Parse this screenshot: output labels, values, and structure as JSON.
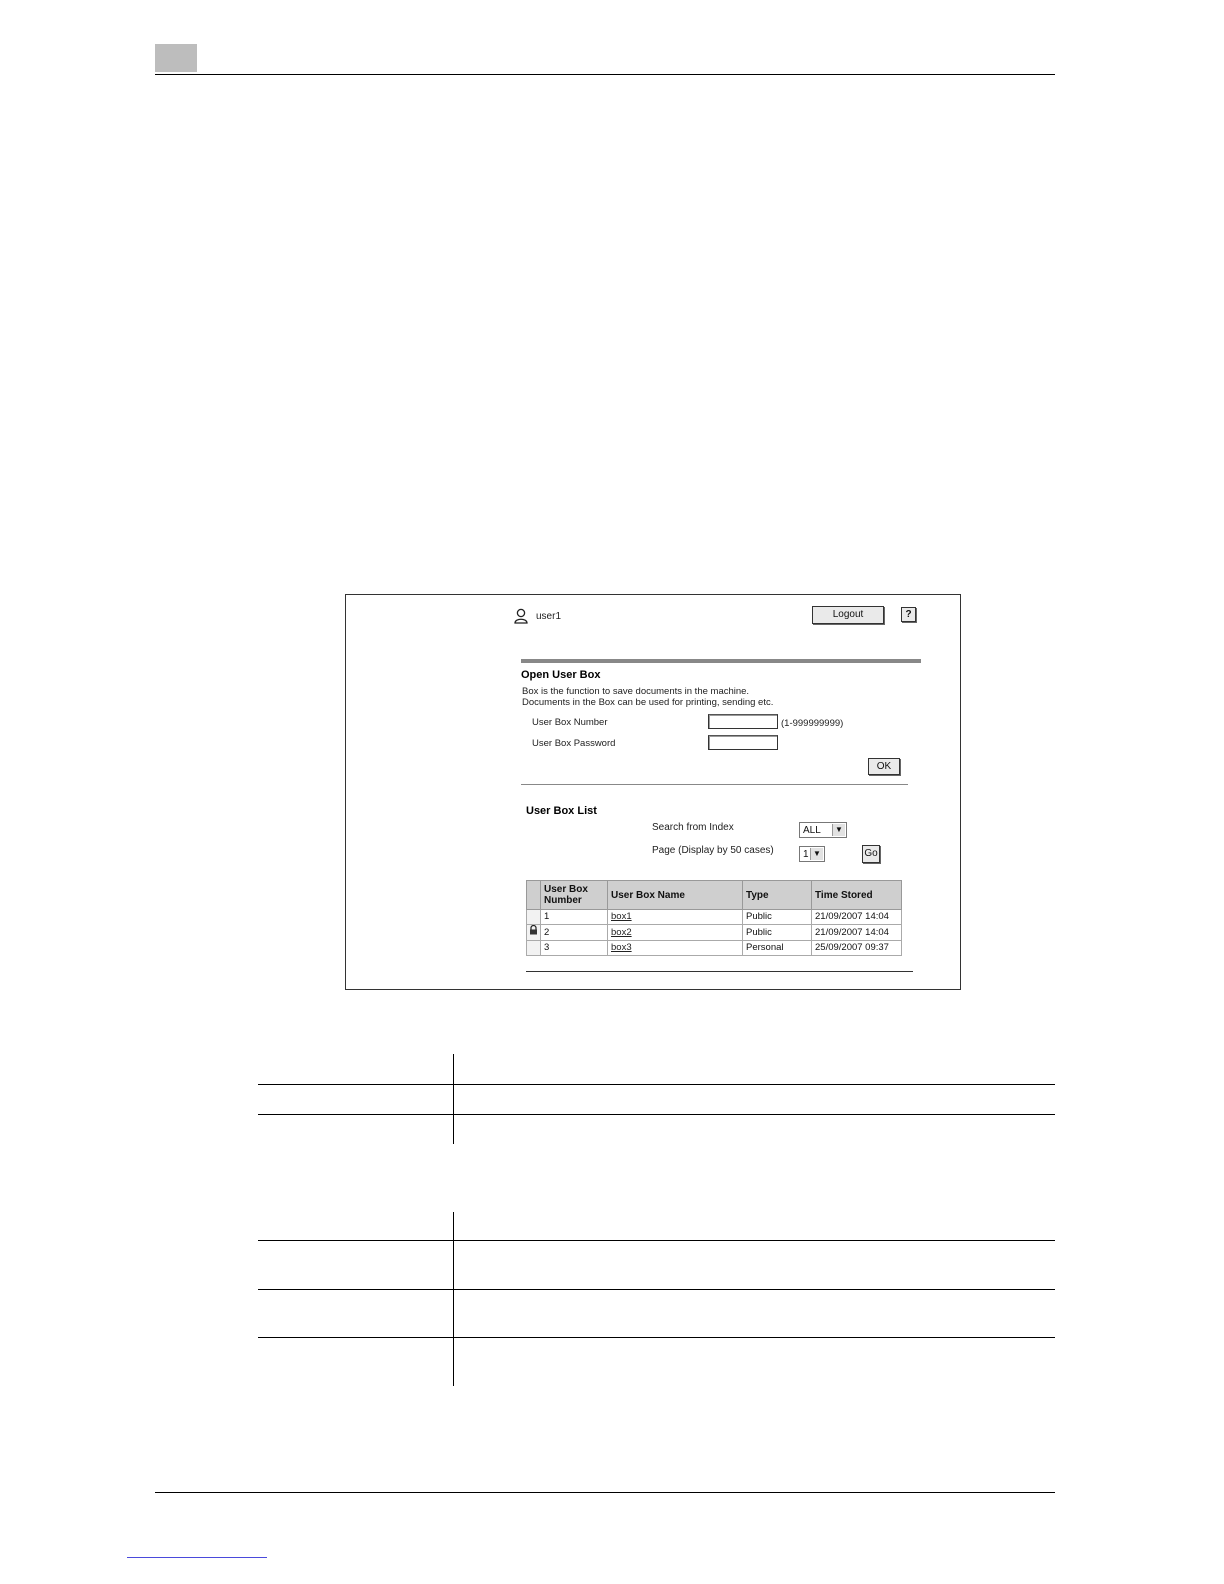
{
  "user_panel": {
    "username": "user1",
    "logout_label": "Logout",
    "help_label": "?"
  },
  "open_box": {
    "title": "Open User Box",
    "desc_line1": "Box is the function to save documents in the machine.",
    "desc_line2": "Documents in the Box can be used for printing, sending etc.",
    "number_label": "User Box Number",
    "number_value": "",
    "number_range": "(1-999999999)",
    "password_label": "User Box Password",
    "password_value": "",
    "ok_label": "OK"
  },
  "box_list": {
    "title": "User Box List",
    "search_label": "Search from Index",
    "search_value": "ALL",
    "page_label": "Page (Display by 50 cases)",
    "page_value": "1",
    "go_label": "Go",
    "columns": [
      "User Box Number",
      "User Box Name",
      "Type",
      "Time Stored"
    ],
    "rows": [
      {
        "locked": false,
        "number": "1",
        "name": "box1",
        "type": "Public",
        "time": "21/09/2007 14:04"
      },
      {
        "locked": true,
        "number": "2",
        "name": "box2",
        "type": "Public",
        "time": "21/09/2007 14:04"
      },
      {
        "locked": false,
        "number": "3",
        "name": "box3",
        "type": "Personal",
        "time": "25/09/2007 09:37"
      }
    ]
  }
}
